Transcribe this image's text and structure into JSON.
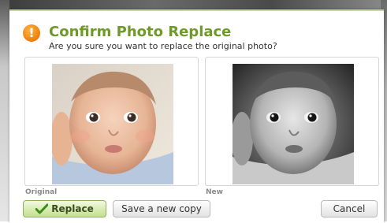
{
  "dialog": {
    "title": "Confirm Photo Replace",
    "subtitle": "Are you sure you want to replace the original photo?",
    "icon": "warning-icon",
    "accent_color": "#6f9a2a",
    "warn_color": "#f28a12"
  },
  "panels": {
    "original_caption": "Original",
    "new_caption": "New"
  },
  "buttons": {
    "replace_label": "Replace",
    "replace_icon": "checkmark-icon",
    "save_copy_label": "Save a new copy",
    "cancel_label": "Cancel"
  }
}
